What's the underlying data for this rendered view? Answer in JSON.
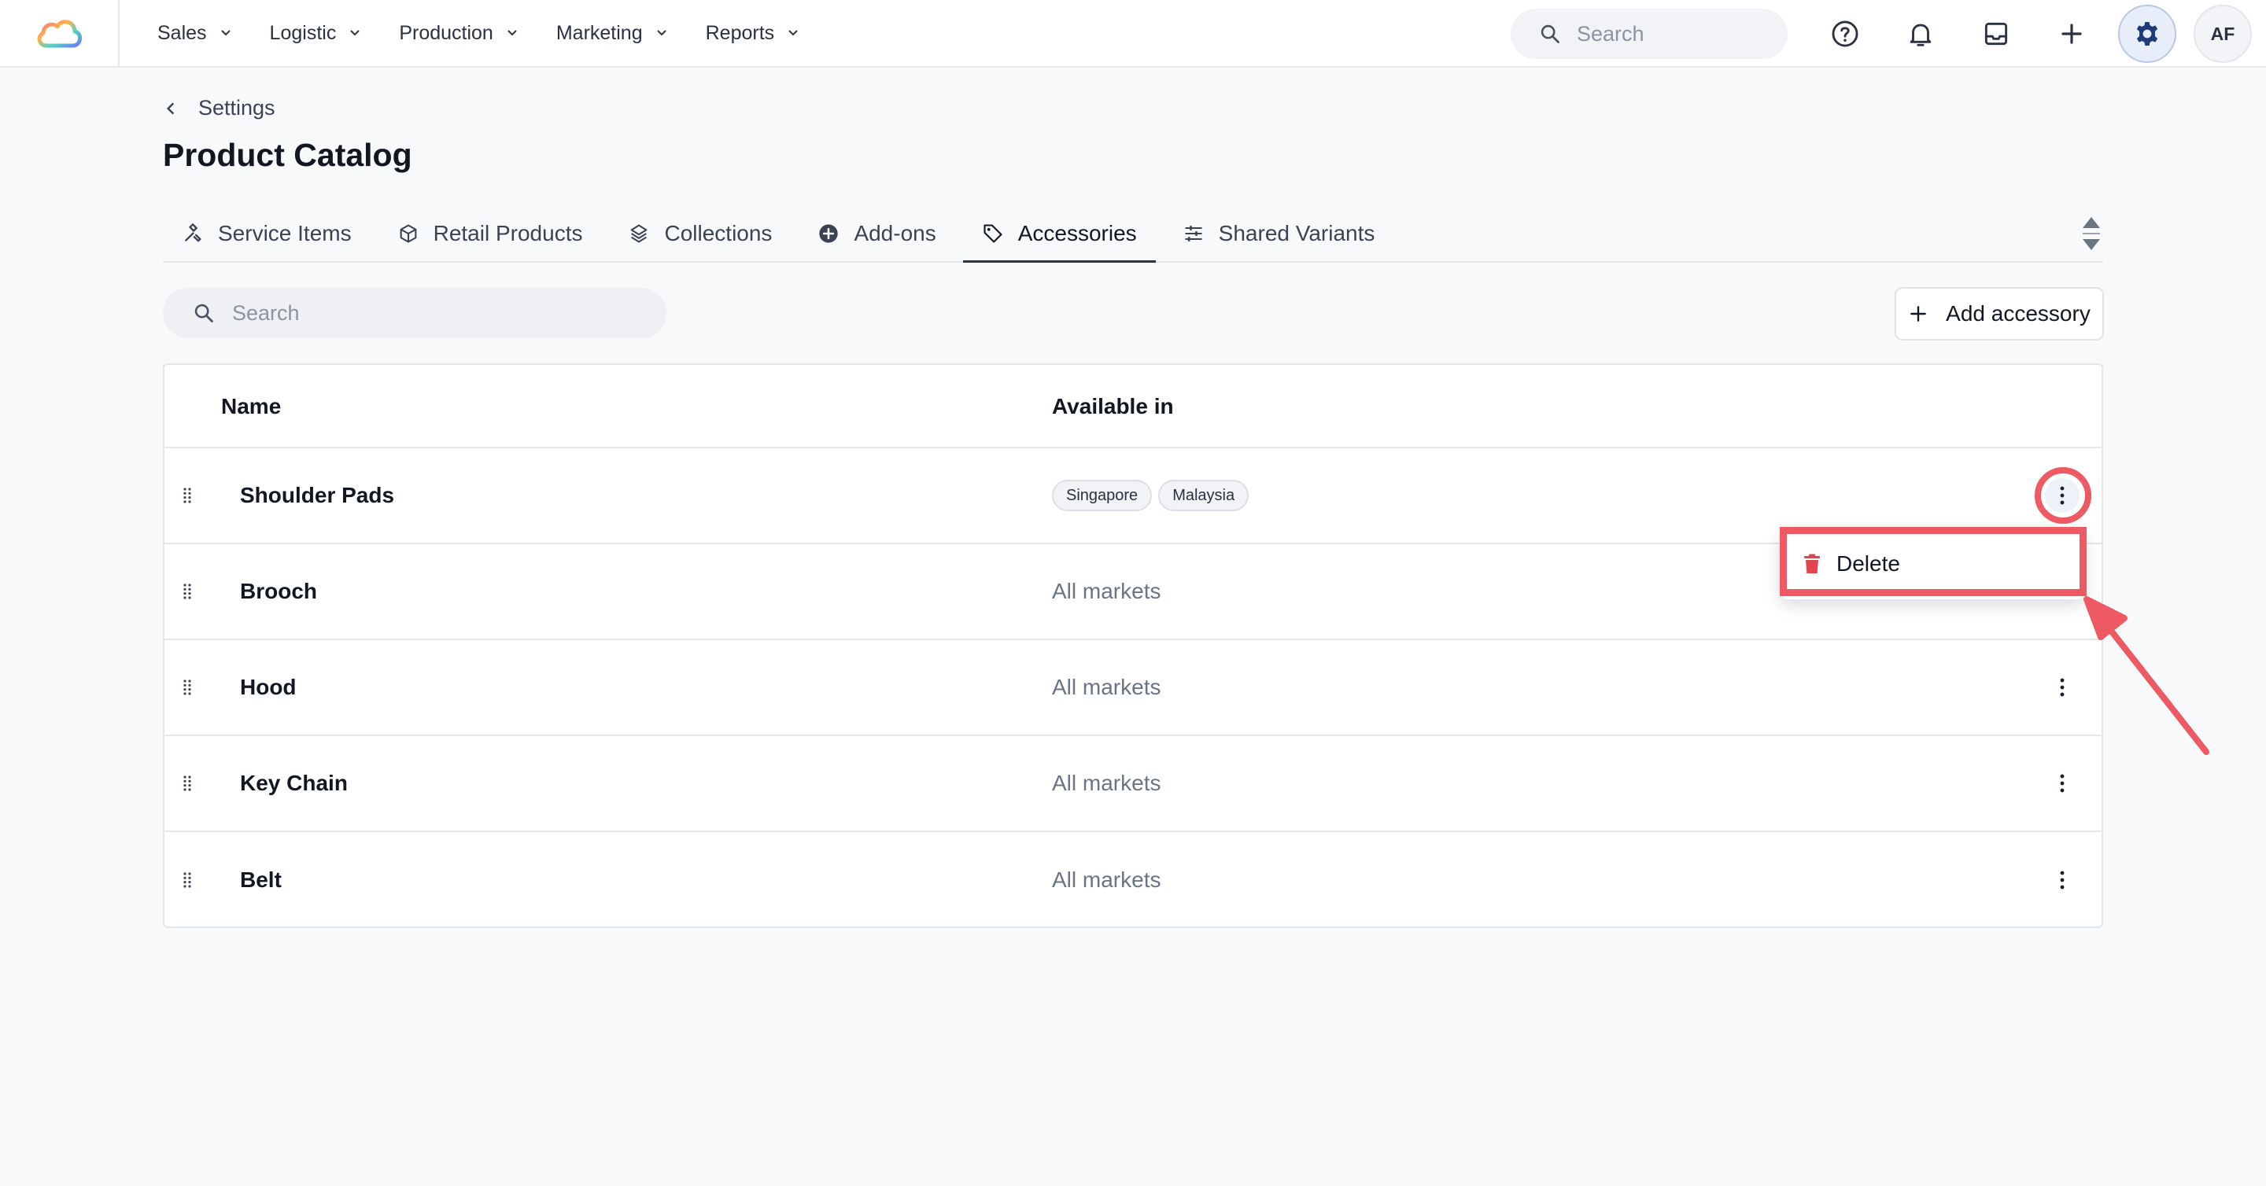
{
  "topbar": {
    "nav": [
      {
        "label": "Sales"
      },
      {
        "label": "Logistic"
      },
      {
        "label": "Production"
      },
      {
        "label": "Marketing"
      },
      {
        "label": "Reports"
      }
    ],
    "search_placeholder": "Search",
    "avatar_initials": "AF",
    "icons": [
      "help-icon",
      "bell-icon",
      "inbox-icon",
      "plus-icon",
      "gear-icon"
    ]
  },
  "page": {
    "breadcrumb": "Settings",
    "title": "Product Catalog"
  },
  "tabs": [
    {
      "label": "Service Items",
      "icon": "tools-icon",
      "active": false
    },
    {
      "label": "Retail Products",
      "icon": "box-icon",
      "active": false
    },
    {
      "label": "Collections",
      "icon": "layers-icon",
      "active": false
    },
    {
      "label": "Add-ons",
      "icon": "plus-circle-icon",
      "active": false
    },
    {
      "label": "Accessories",
      "icon": "tag-icon",
      "active": true
    },
    {
      "label": "Shared Variants",
      "icon": "sliders-icon",
      "active": false
    }
  ],
  "toolbar": {
    "search_placeholder": "Search",
    "add_label": "Add accessory"
  },
  "table": {
    "columns": [
      "Name",
      "Available in"
    ],
    "rows": [
      {
        "name": "Shoulder Pads",
        "available": "",
        "chips": [
          "Singapore",
          "Malaysia"
        ]
      },
      {
        "name": "Brooch",
        "available": "All markets",
        "chips": []
      },
      {
        "name": "Hood",
        "available": "All markets",
        "chips": []
      },
      {
        "name": "Key Chain",
        "available": "All markets",
        "chips": []
      },
      {
        "name": "Belt",
        "available": "All markets",
        "chips": []
      }
    ]
  },
  "context_menu": {
    "items": [
      {
        "label": "Delete",
        "icon": "trash-icon"
      }
    ]
  },
  "colors": {
    "annotation": "#ee5a64",
    "delete_icon": "#e2454f",
    "gear_active_bg": "#e8eef9"
  }
}
